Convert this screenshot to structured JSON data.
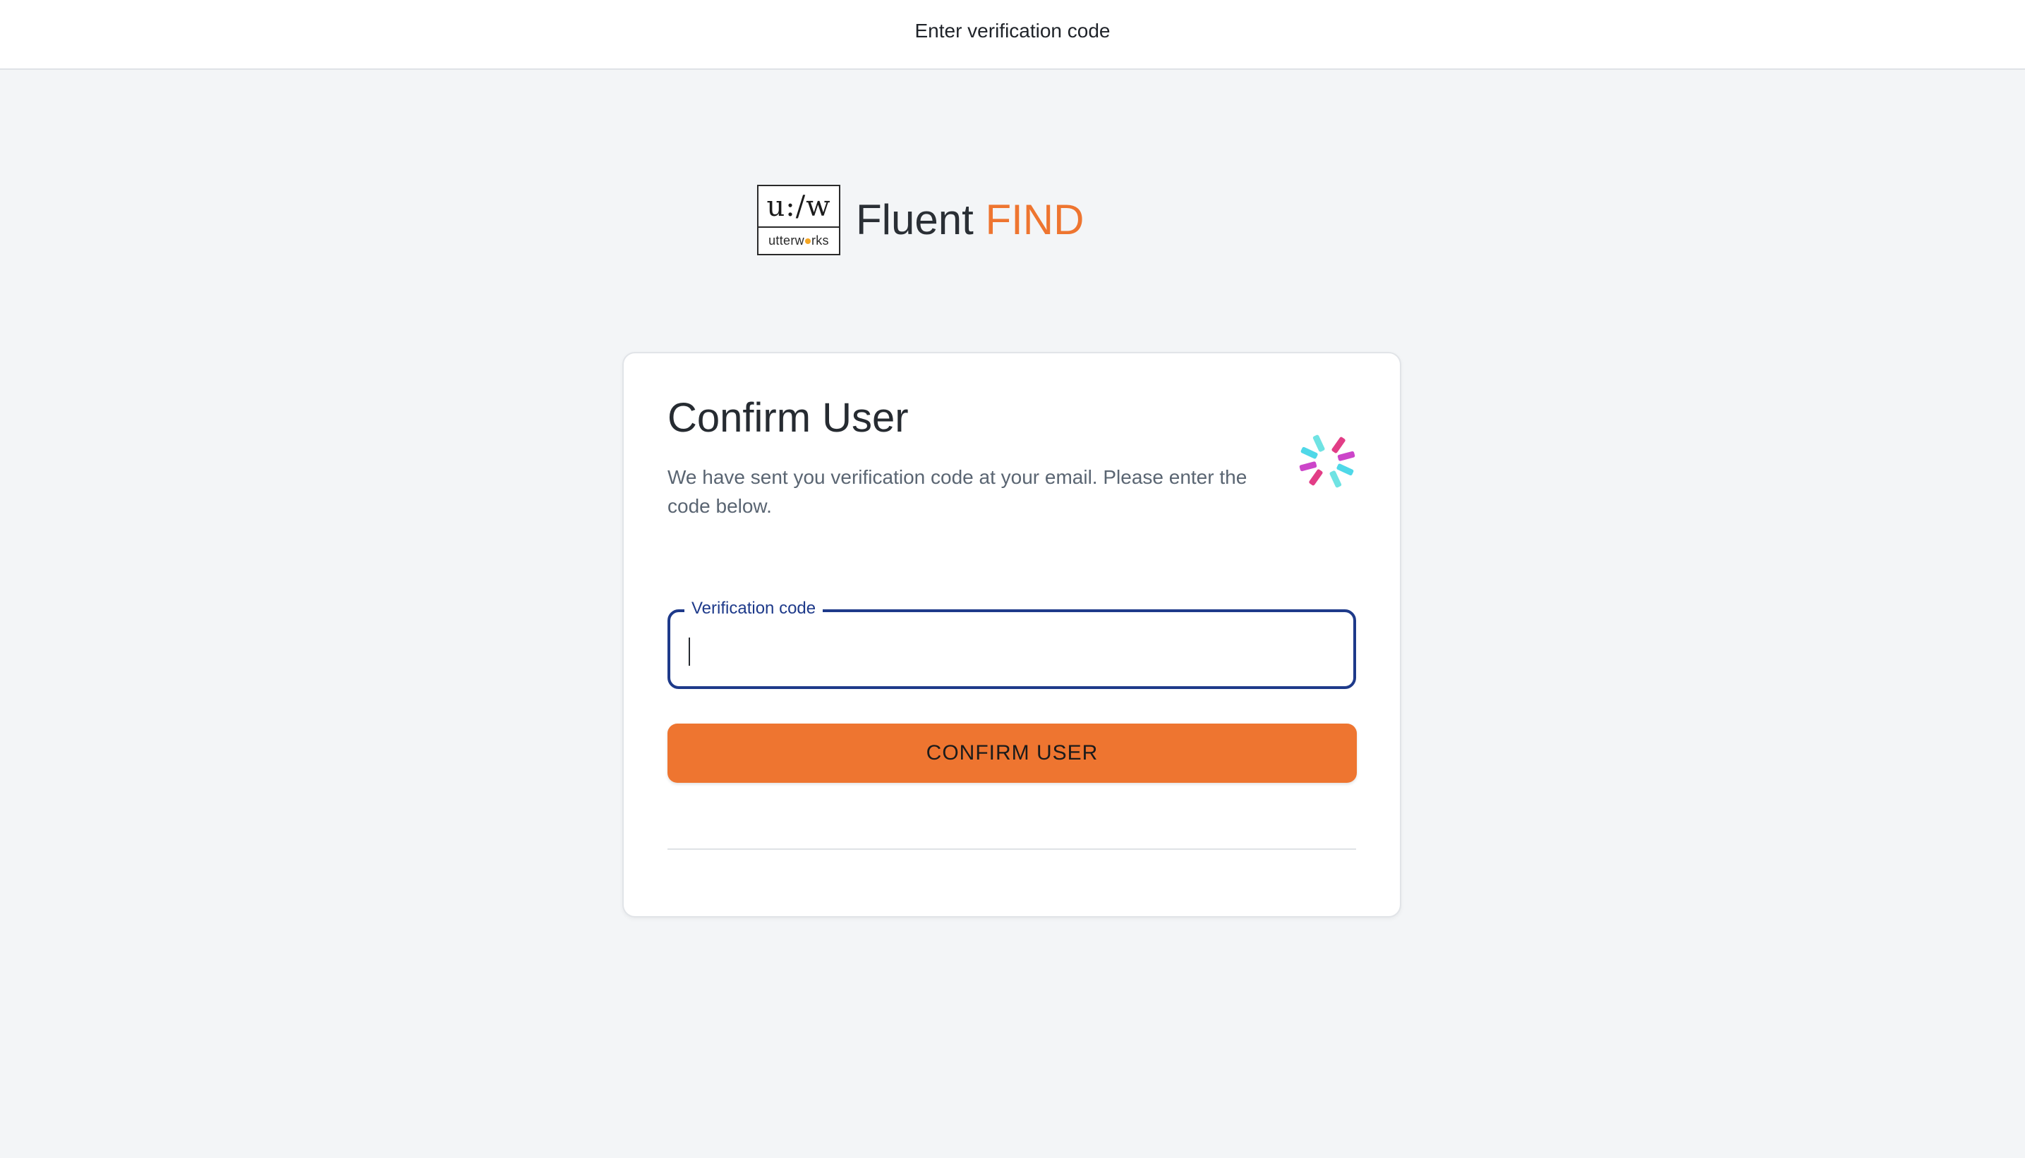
{
  "header": {
    "title": "Enter verification code"
  },
  "brand": {
    "logo_top": "u:/w",
    "logo_bottom_pre": "utterw",
    "logo_bottom_post": "rks",
    "name_primary": "Fluent",
    "name_accent": "FIND",
    "accent_color": "#ee7530"
  },
  "card": {
    "title": "Confirm User",
    "description": "We have sent you verification code at your email. Please enter the code below.",
    "icon": "sparkle-icon"
  },
  "form": {
    "verification_label": "Verification code",
    "verification_value": "",
    "submit_label": "CONFIRM USER",
    "focus_color": "#1e3a8a"
  }
}
